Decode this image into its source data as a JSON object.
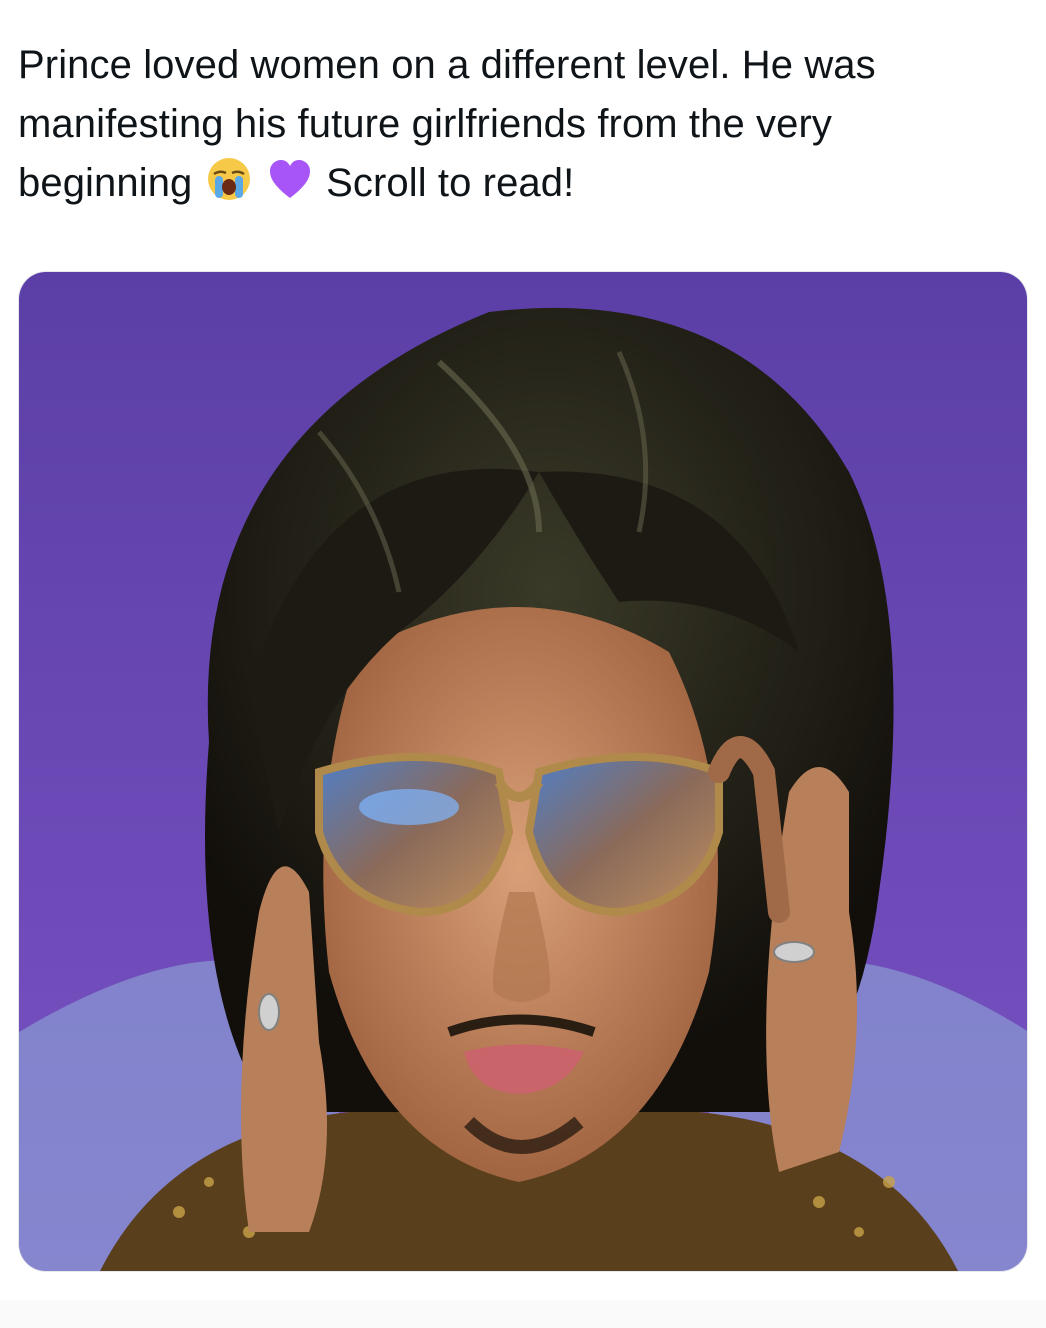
{
  "tweet": {
    "text_lines": [
      "Prince loved women on a different level. He was",
      "manifesting his future girlfriends from the very",
      "beginning",
      "Scroll to read!"
    ],
    "emojis": [
      "loudly-crying-face-icon",
      "purple-heart-icon"
    ]
  },
  "media": {
    "colors": {
      "background_top": "#5b3fa6",
      "background_bottom": "#7a52c4",
      "hair": "#1d1a14",
      "skin": "#c88a5e",
      "lens": "#3a5fa0",
      "lips": "#c8646a"
    }
  }
}
